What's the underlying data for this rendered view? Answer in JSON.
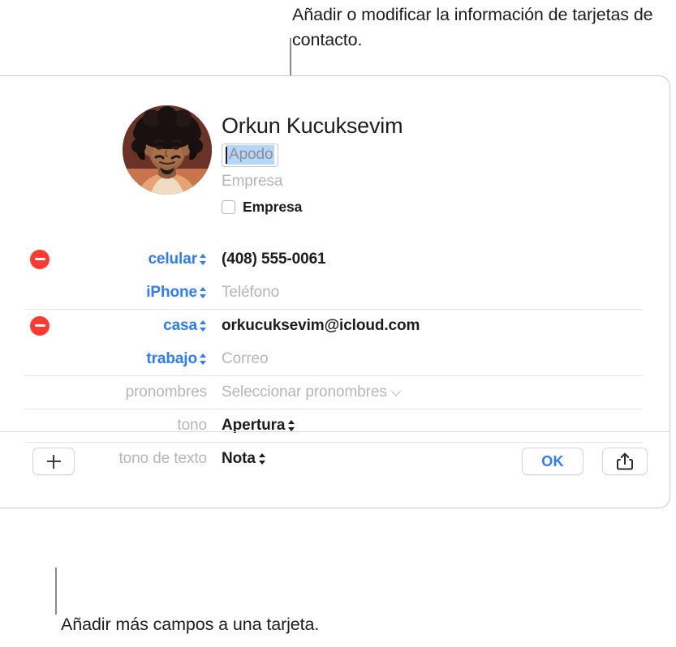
{
  "annotations": {
    "top": "Añadir o modificar la información de tarjetas de contacto.",
    "bottom": "Añadir más campos a una tarjeta."
  },
  "card": {
    "avatar_alt": "contact-photo",
    "name": "Orkun  Kucuksevim",
    "nickname_value": "Apodo",
    "company_placeholder": "Empresa",
    "company_checkbox_label": "Empresa",
    "company_checked": false,
    "fields": [
      {
        "label": "celular",
        "label_style": "blue",
        "value": "(408) 555-0061",
        "value_style": "filled",
        "control": "stepper",
        "removable": true,
        "separator": false
      },
      {
        "label": "iPhone",
        "label_style": "blue",
        "value": "Teléfono",
        "value_style": "placeholder",
        "control": "stepper",
        "removable": false,
        "separator": false
      },
      {
        "label": "casa",
        "label_style": "blue",
        "value": "orkucuksevim@icloud.com",
        "value_style": "filled",
        "control": "stepper",
        "removable": true,
        "separator": true
      },
      {
        "label": "trabajo",
        "label_style": "blue",
        "value": "Correo",
        "value_style": "placeholder",
        "control": "stepper",
        "removable": false,
        "separator": false
      },
      {
        "label": "pronombres",
        "label_style": "grey",
        "value": "Seleccionar pronombres",
        "value_style": "placeholder",
        "control": "chevron",
        "removable": false,
        "separator": true
      },
      {
        "label": "tono",
        "label_style": "grey",
        "value": "Apertura",
        "value_style": "filled",
        "control": "stepper",
        "removable": false,
        "separator": true
      },
      {
        "label": "tono de texto",
        "label_style": "grey",
        "value": "Nota",
        "value_style": "filled",
        "control": "stepper",
        "removable": false,
        "separator": true
      }
    ]
  },
  "toolbar": {
    "add_field_icon": "plus-icon",
    "ok_label": "OK",
    "share_icon": "share-icon"
  },
  "colors": {
    "accent_blue": "#2f7cf6",
    "remove_red": "#fb3b30",
    "placeholder_grey": "#b6b6ba",
    "selection_blue": "#b4d6fb",
    "separator": "#e3e3e5"
  }
}
